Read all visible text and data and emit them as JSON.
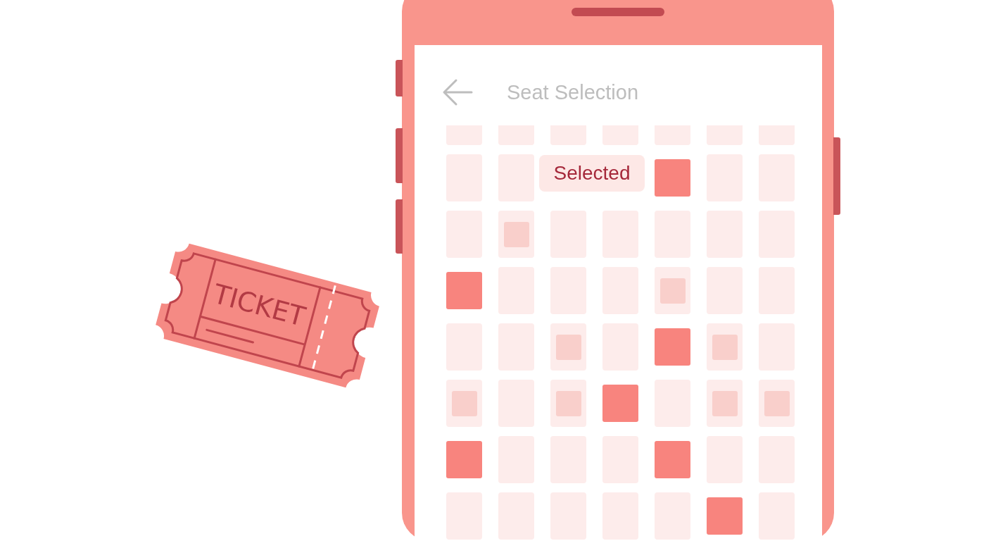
{
  "ticket": {
    "text": "TICKET"
  },
  "phone": {
    "title": "Seat Selection",
    "rows": [
      {
        "seats": [
          {
            "kind": "seat",
            "selected": false,
            "held": false
          },
          {
            "kind": "seat",
            "selected": false,
            "held": false
          },
          {
            "kind": "seat",
            "selected": false,
            "held": false
          },
          {
            "kind": "seat",
            "selected": false,
            "held": false
          },
          {
            "kind": "seat",
            "selected": false,
            "held": false
          },
          {
            "kind": "seat",
            "selected": false,
            "held": false
          },
          {
            "kind": "seat",
            "selected": false,
            "held": false
          }
        ]
      },
      {
        "seats": [
          {
            "kind": "seat",
            "selected": false,
            "held": false
          },
          {
            "kind": "seat",
            "selected": false,
            "held": false
          },
          {
            "kind": "tag",
            "text": "Selected"
          },
          {
            "kind": "seat",
            "selected": true,
            "held": false
          },
          {
            "kind": "seat",
            "selected": false,
            "held": false
          },
          {
            "kind": "seat",
            "selected": false,
            "held": false
          }
        ]
      },
      {
        "seats": [
          {
            "kind": "seat",
            "selected": false,
            "held": false
          },
          {
            "kind": "seat",
            "selected": false,
            "held": true
          },
          {
            "kind": "seat",
            "selected": false,
            "held": false
          },
          {
            "kind": "seat",
            "selected": false,
            "held": false
          },
          {
            "kind": "seat",
            "selected": false,
            "held": false
          },
          {
            "kind": "seat",
            "selected": false,
            "held": false
          },
          {
            "kind": "seat",
            "selected": false,
            "held": false
          }
        ]
      },
      {
        "seats": [
          {
            "kind": "seat",
            "selected": true,
            "held": false
          },
          {
            "kind": "seat",
            "selected": false,
            "held": false
          },
          {
            "kind": "seat",
            "selected": false,
            "held": false
          },
          {
            "kind": "seat",
            "selected": false,
            "held": false
          },
          {
            "kind": "seat",
            "selected": false,
            "held": true
          },
          {
            "kind": "seat",
            "selected": false,
            "held": false
          },
          {
            "kind": "seat",
            "selected": false,
            "held": false
          }
        ]
      },
      {
        "seats": [
          {
            "kind": "seat",
            "selected": false,
            "held": false
          },
          {
            "kind": "seat",
            "selected": false,
            "held": false
          },
          {
            "kind": "seat",
            "selected": false,
            "held": true
          },
          {
            "kind": "seat",
            "selected": false,
            "held": false
          },
          {
            "kind": "seat",
            "selected": true,
            "held": false
          },
          {
            "kind": "seat",
            "selected": false,
            "held": true
          },
          {
            "kind": "seat",
            "selected": false,
            "held": false
          }
        ]
      },
      {
        "seats": [
          {
            "kind": "seat",
            "selected": false,
            "held": true
          },
          {
            "kind": "seat",
            "selected": false,
            "held": false
          },
          {
            "kind": "seat",
            "selected": false,
            "held": true
          },
          {
            "kind": "seat",
            "selected": true,
            "held": false
          },
          {
            "kind": "seat",
            "selected": false,
            "held": false
          },
          {
            "kind": "seat",
            "selected": false,
            "held": true
          },
          {
            "kind": "seat",
            "selected": false,
            "held": true
          }
        ]
      },
      {
        "seats": [
          {
            "kind": "seat",
            "selected": true,
            "held": false
          },
          {
            "kind": "seat",
            "selected": false,
            "held": false
          },
          {
            "kind": "seat",
            "selected": false,
            "held": false
          },
          {
            "kind": "seat",
            "selected": false,
            "held": false
          },
          {
            "kind": "seat",
            "selected": true,
            "held": false
          },
          {
            "kind": "seat",
            "selected": false,
            "held": false
          },
          {
            "kind": "seat",
            "selected": false,
            "held": false
          }
        ]
      },
      {
        "seats": [
          {
            "kind": "seat",
            "selected": false,
            "held": false
          },
          {
            "kind": "seat",
            "selected": false,
            "held": false
          },
          {
            "kind": "seat",
            "selected": false,
            "held": false
          },
          {
            "kind": "seat",
            "selected": false,
            "held": false
          },
          {
            "kind": "seat",
            "selected": false,
            "held": false
          },
          {
            "kind": "seat",
            "selected": true,
            "held": false
          },
          {
            "kind": "seat",
            "selected": false,
            "held": false
          }
        ]
      }
    ]
  }
}
